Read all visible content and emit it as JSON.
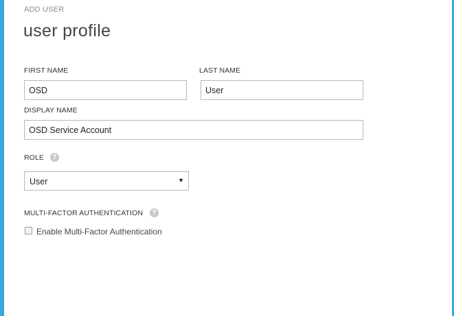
{
  "dialog": {
    "kicker": "ADD USER",
    "title": "user profile",
    "close_glyph": "ˆ"
  },
  "form": {
    "first_name": {
      "label": "FIRST NAME",
      "value": "OSD"
    },
    "last_name": {
      "label": "LAST NAME",
      "value": "User"
    },
    "display_name": {
      "label": "DISPLAY NAME",
      "value": "OSD Service Account"
    },
    "role": {
      "label": "ROLE",
      "value": "User",
      "help_glyph": "?"
    },
    "mfa": {
      "label": "MULTI-FACTOR AUTHENTICATION",
      "help_glyph": "?",
      "checkbox_label": "Enable Multi-Factor Authentication",
      "checked": false
    }
  },
  "colors": {
    "accent": "#3aa6dc",
    "border": "#b8b8b8",
    "help_icon": "#c8c8c8"
  },
  "icons": {
    "close": "close-icon",
    "help": "help-icon",
    "dropdown": "dropdown-arrow-icon"
  }
}
